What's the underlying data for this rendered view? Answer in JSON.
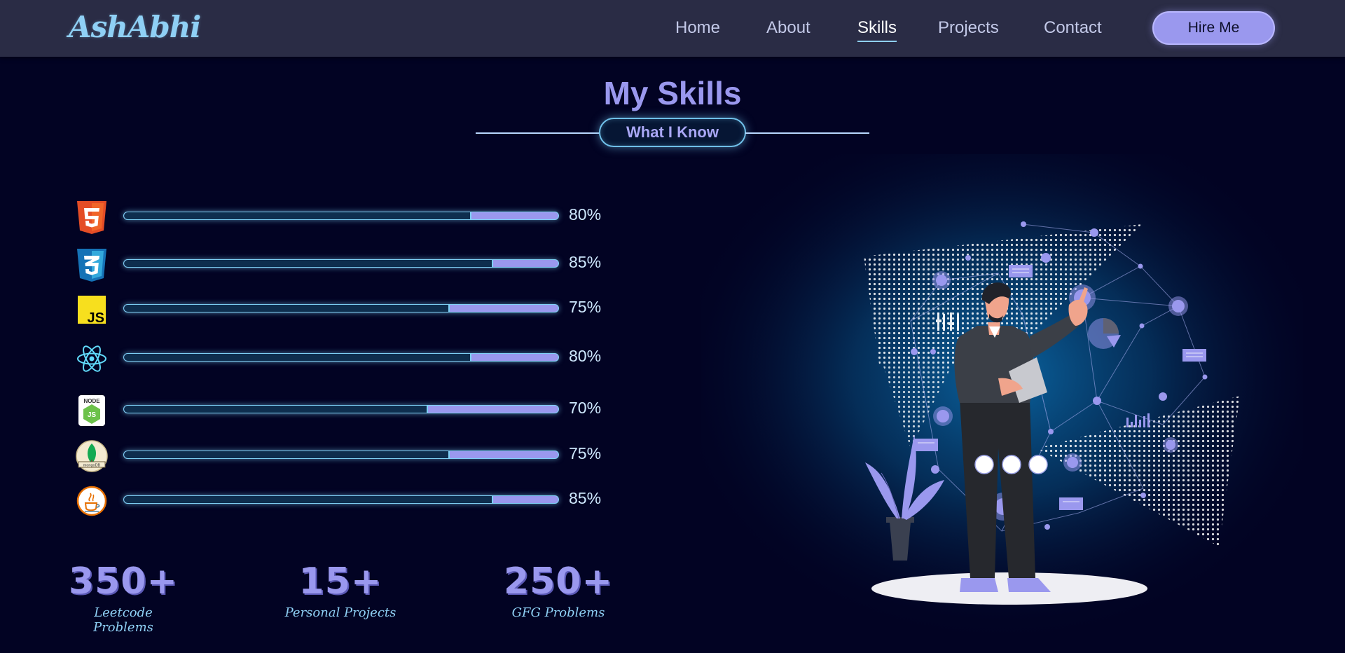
{
  "nav": {
    "logo": "AshAbhi",
    "links": [
      "Home",
      "About",
      "Skills",
      "Projects",
      "Contact"
    ],
    "active": "Skills",
    "cta_label": "Hire Me"
  },
  "section": {
    "title": "My Skills",
    "subtitle": "What I Know"
  },
  "skills": [
    {
      "icon": "html5-icon",
      "percent_label": "80%",
      "level": 0.8
    },
    {
      "icon": "css3-icon",
      "percent_label": "85%",
      "level": 0.85
    },
    {
      "icon": "javascript-icon",
      "percent_label": "75%",
      "level": 0.75
    },
    {
      "icon": "react-icon",
      "percent_label": "80%",
      "level": 0.8
    },
    {
      "icon": "nodejs-icon",
      "percent_label": "70%",
      "level": 0.7
    },
    {
      "icon": "mongodb-icon",
      "percent_label": "75%",
      "level": 0.75
    },
    {
      "icon": "java-icon",
      "percent_label": "85%",
      "level": 0.85
    }
  ],
  "stats": [
    {
      "value": "350+",
      "label": "Leetcode Problems"
    },
    {
      "value": "15+",
      "label": "Personal Projects"
    },
    {
      "value": "250+",
      "label": "GFG Problems"
    }
  ],
  "colors": {
    "background": "#020323",
    "navbar": "#2a2c45",
    "accent": "#9a98ee",
    "glow": "#7ed0f5"
  }
}
